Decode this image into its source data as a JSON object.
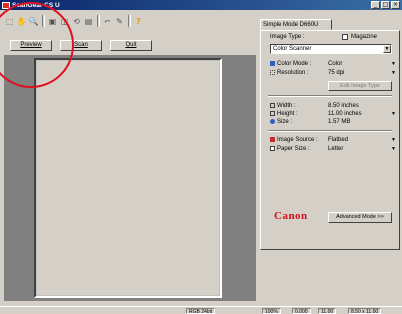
{
  "window": {
    "title": "ScanGear CS U",
    "min_glyph": "_",
    "max_glyph": "□",
    "close_glyph": "×"
  },
  "toolbar": {
    "icons": [
      "marquee-icon",
      "hand-icon",
      "zoom-icon",
      "auto-crop-icon",
      "mirror-icon",
      "rotate-icon",
      "crop-icon",
      "eyedropper-icon",
      "help-icon"
    ]
  },
  "preview_buttons": {
    "preview": "Preview",
    "scan": "Scan",
    "quit": "Quit"
  },
  "settings": {
    "tab_label": "Simple Mode  D660U",
    "image_type_label": "Image Type :",
    "magazine_label": "Magazine",
    "image_type_value": "Color Scanner",
    "color_mode_label": "Color Mode :",
    "color_mode_value": "Color",
    "resolution_label": "Resolution :",
    "resolution_value": "75 dpi",
    "edit_button": "Edit Image Type",
    "width_label": "Width :",
    "width_value": "8.50 inches",
    "height_label": "Height :",
    "height_value": "11.00 inches",
    "size_label": "Size :",
    "size_value": "1.57 MB",
    "image_source_label": "Image Source :",
    "image_source_value": "Flatbed",
    "paper_size_label": "Paper Size :",
    "paper_size_value": "Letter",
    "brand": "Canon",
    "advanced_button": "Advanced Mode >>"
  },
  "status": {
    "mode": "RGB 24bit",
    "zoom": "100%",
    "pos1": "0.000",
    "pos2": "11.00",
    "size": "8.50 x 11.00"
  },
  "colors": {
    "annotation_circle": "#e01020",
    "brand": "#d01018"
  }
}
